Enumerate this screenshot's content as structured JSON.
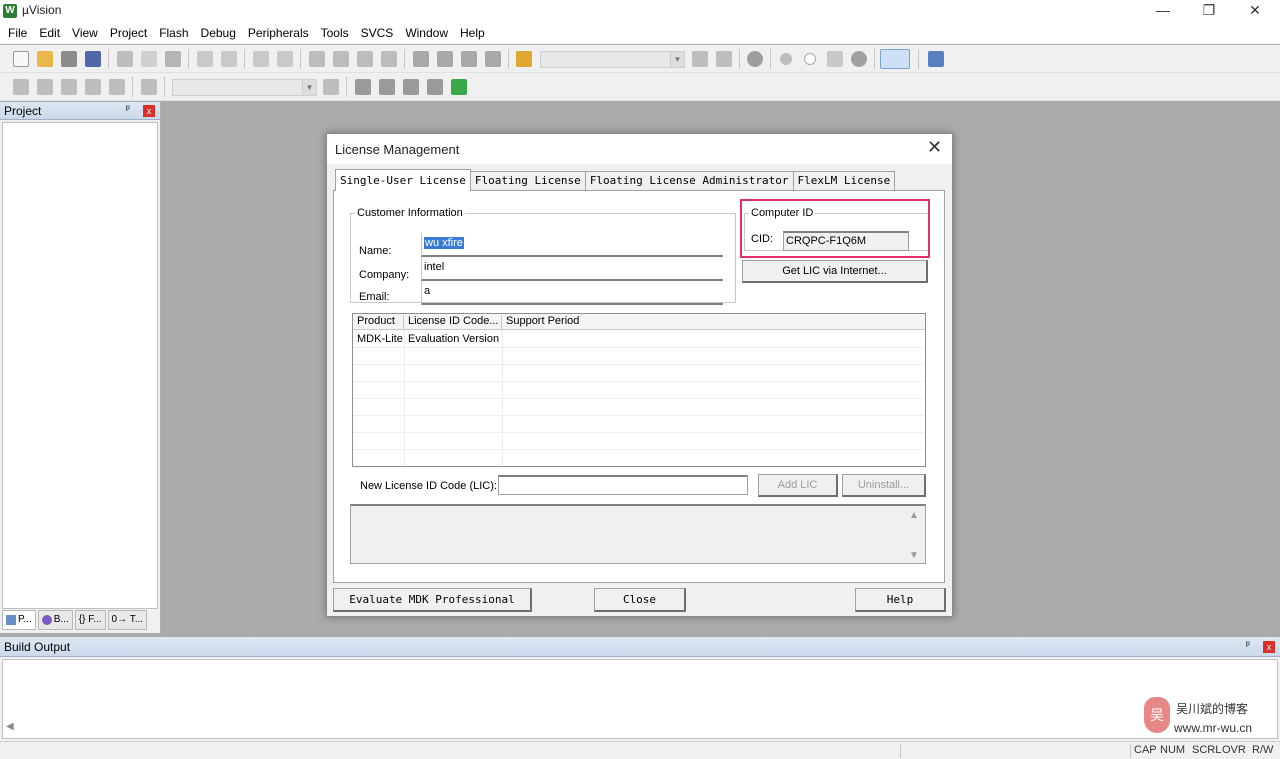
{
  "window": {
    "title": "µVision",
    "minimize": "—",
    "maximize": "❐",
    "close": "✕"
  },
  "menu": [
    "File",
    "Edit",
    "View",
    "Project",
    "Flash",
    "Debug",
    "Peripherals",
    "Tools",
    "SVCS",
    "Window",
    "Help"
  ],
  "project_panel": {
    "title": "Project",
    "pin": "ᵖ",
    "close": "x",
    "tabs": [
      "P...",
      "B...",
      "{} F...",
      "0→ T..."
    ]
  },
  "dialog": {
    "title": "License Management",
    "close": "✕",
    "tabs": [
      "Single-User License",
      "Floating License",
      "Floating License Administrator",
      "FlexLM License"
    ],
    "customer_info": {
      "legend": "Customer Information",
      "name_label": "Name:",
      "name_value": "wu xfire",
      "company_label": "Company:",
      "company_value": "intel",
      "email_label": "Email:",
      "email_value": "a"
    },
    "computer_id": {
      "legend": "Computer ID",
      "cid_label": "CID:",
      "cid_value": "CRQPC-F1Q6M"
    },
    "get_lic_button": "Get LIC via Internet...",
    "table": {
      "headers": [
        "Product",
        "License ID Code...",
        "Support Period"
      ],
      "rows": [
        [
          "MDK-Lite",
          "Evaluation Version",
          ""
        ]
      ]
    },
    "new_lic_label": "New License ID Code (LIC):",
    "new_lic_value": "",
    "add_lic_button": "Add LIC",
    "uninstall_button": "Uninstall...",
    "evaluate_button": "Evaluate MDK Professional",
    "close_button": "Close",
    "help_button": "Help"
  },
  "build_output": {
    "title": "Build Output",
    "pin": "ᵖ",
    "close": "x"
  },
  "status_bar": [
    "CAP",
    "NUM",
    "SCRL",
    "OVR",
    "R/W"
  ],
  "watermark": {
    "logo": "吴",
    "name": "吴川斌的博客",
    "url": "www.mr-wu.cn"
  },
  "colors": {
    "highlight_border": "#e0306a",
    "selection": "#3a7bd5",
    "close_red": "#d9302a",
    "workspace_bg": "#ababab"
  }
}
